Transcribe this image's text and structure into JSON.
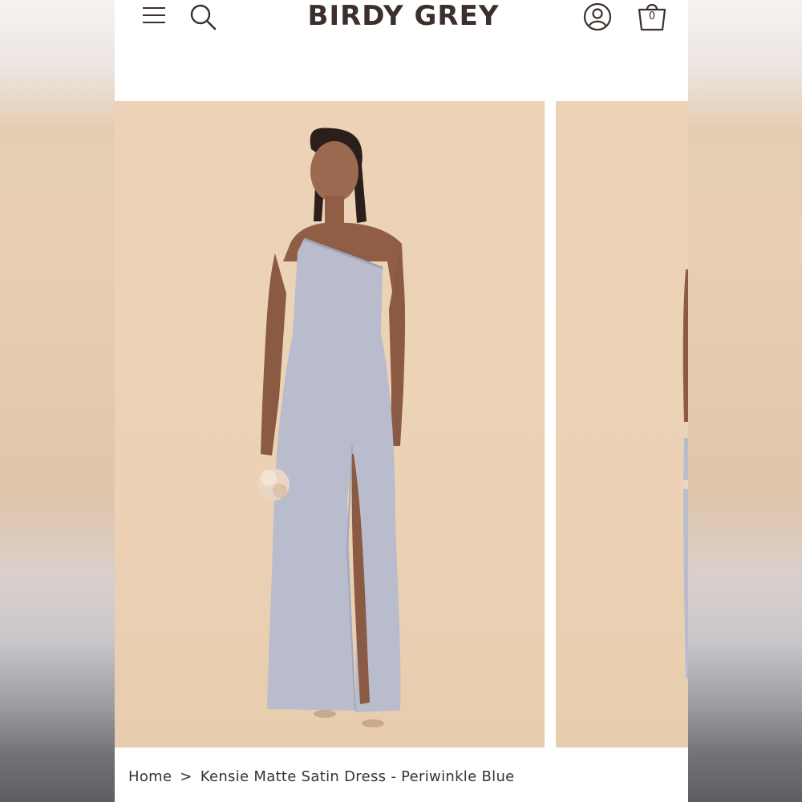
{
  "brand": {
    "name": "BIRDY GREY"
  },
  "header": {
    "menu_icon": "hamburger-menu-icon",
    "search_icon": "search-icon",
    "account_icon": "user-account-icon",
    "cart_icon": "shopping-bag-icon",
    "cart_count": "0"
  },
  "gallery": {
    "background_color": "#ecd2b7",
    "dress_color": "#b9bccd",
    "images": [
      {
        "type": "model-photo",
        "state": "current"
      },
      {
        "type": "model-photo",
        "state": "next-partial"
      }
    ]
  },
  "breadcrumb": {
    "home": "Home",
    "separator": ">",
    "current": "Kensie Matte Satin Dress - Periwinkle Blue"
  }
}
